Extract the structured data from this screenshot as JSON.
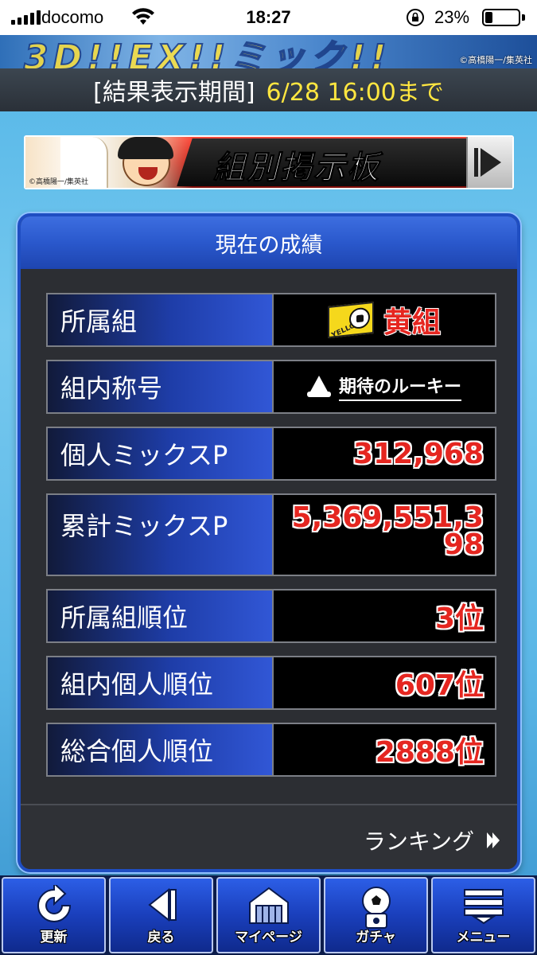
{
  "status_bar": {
    "carrier": "docomo",
    "time": "18:27",
    "battery_percent": "23%",
    "battery_level": 0.23
  },
  "top_banner": {
    "copyright": "©高橋陽一/集英社"
  },
  "result_period": {
    "label": "[結果表示期間]",
    "value": "6/28 16:00まで"
  },
  "board_banner": {
    "title": "組別掲示板",
    "copyright": "©高橋陽一/集英社"
  },
  "panel": {
    "title": "現在の成績",
    "rows": [
      {
        "label": "所属組",
        "value": "黄組",
        "flag_text": "YELLOW"
      },
      {
        "label": "組内称号",
        "value": "期待のルーキー"
      },
      {
        "label": "個人ミックスP",
        "value": "312,968"
      },
      {
        "label": "累計ミックスP",
        "value": "5,369,551,398"
      },
      {
        "label": "所属組順位",
        "value": "3位"
      },
      {
        "label": "組内個人順位",
        "value": "607位"
      },
      {
        "label": "総合個人順位",
        "value": "2888位"
      }
    ],
    "ranking_link": "ランキング"
  },
  "bottom_nav": [
    {
      "label": "更新",
      "icon": "refresh-icon"
    },
    {
      "label": "戻る",
      "icon": "back-arrow-icon"
    },
    {
      "label": "マイページ",
      "icon": "home-icon"
    },
    {
      "label": "ガチャ",
      "icon": "gacha-icon"
    },
    {
      "label": "メニュー",
      "icon": "menu-icon"
    }
  ],
  "colors": {
    "accent_blue": "#2a58cc",
    "value_red": "#e52620",
    "period_yellow": "#ffe640"
  }
}
